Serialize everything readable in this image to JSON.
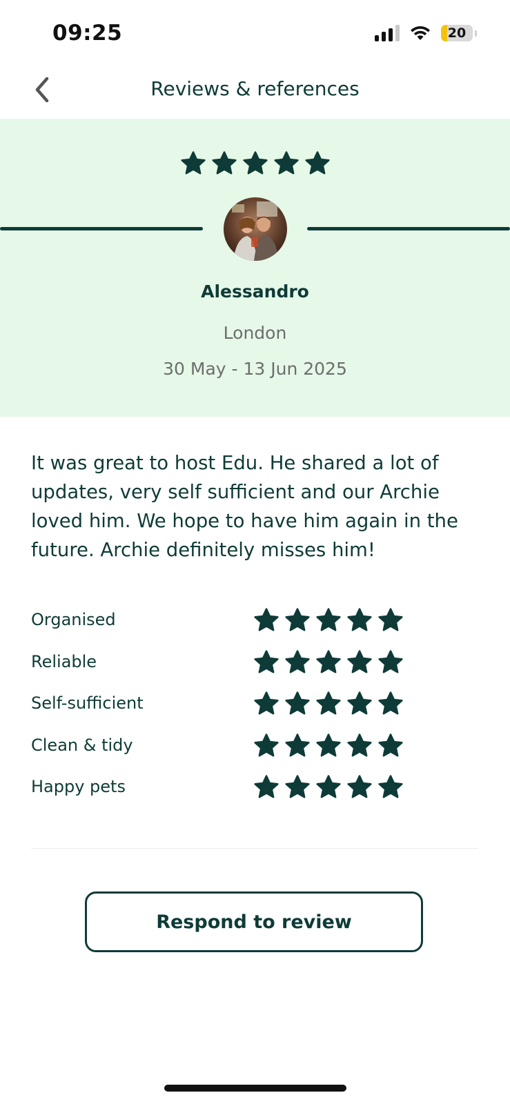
{
  "status_bar": {
    "time": "09:25",
    "battery_level": "20",
    "signal_bars_active": 3,
    "signal_bars_total": 4
  },
  "header": {
    "title": "Reviews & references",
    "back_icon": "chevron-left-icon"
  },
  "review": {
    "overall_rating": 5,
    "reviewer_name": "Alessandro",
    "location": "London",
    "dates": "30 May - 13 Jun 2025",
    "text": "It was great to host Edu. He shared a lot of updates, very self sufficient and our Archie loved him. We hope to have him again in the future. Archie definitely misses him!",
    "categories": [
      {
        "label": "Organised",
        "rating": 5
      },
      {
        "label": "Reliable",
        "rating": 5
      },
      {
        "label": "Self-sufficient",
        "rating": 5
      },
      {
        "label": "Clean & tidy",
        "rating": 5
      },
      {
        "label": "Happy pets",
        "rating": 5
      }
    ]
  },
  "actions": {
    "respond_label": "Respond to review"
  },
  "colors": {
    "brand_dark": "#0e3b37",
    "hero_background": "#e6f8e8",
    "muted_text": "#6d6d6d",
    "battery_accent": "#f4c20d"
  }
}
